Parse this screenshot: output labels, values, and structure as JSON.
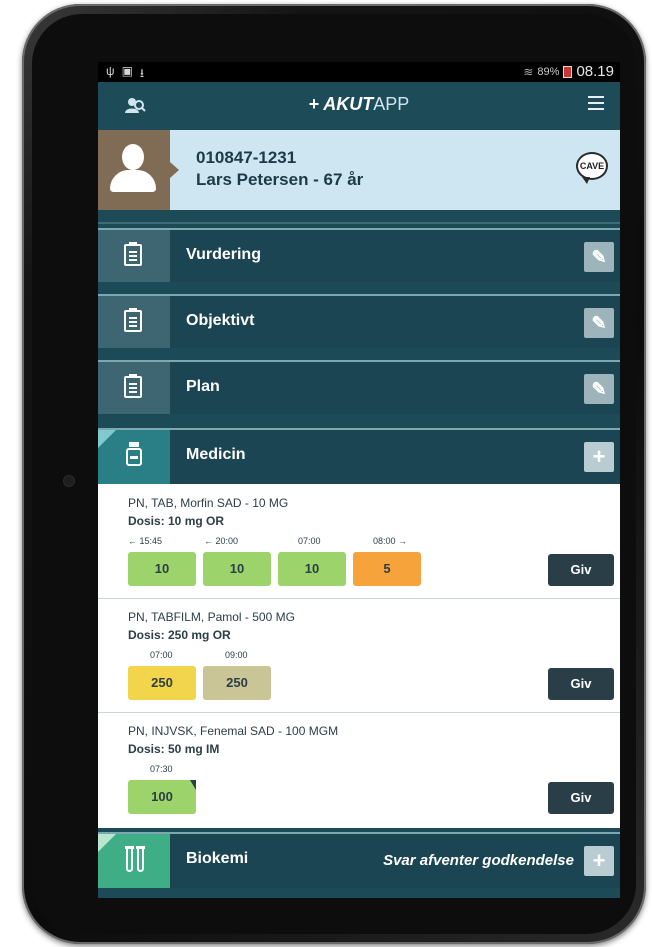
{
  "status_bar": {
    "left_icons": [
      "usb-icon",
      "screenshot-icon",
      "download-icon"
    ],
    "signal_icon": "wifi-icon",
    "battery": "89%",
    "time": "08.19"
  },
  "header": {
    "plus": "+",
    "brand_bold": "AKUT",
    "brand_light": "APP",
    "user_icon": "user-search-icon",
    "menu_icon": "hamburger-menu-icon"
  },
  "patient": {
    "cpr": "010847-1231",
    "name_age": "Lars Petersen - 67 år",
    "cave_label": "CAVE"
  },
  "sections": [
    {
      "label": "Vurdering",
      "icon": "clipboard-icon",
      "action_icon": "edit-icon"
    },
    {
      "label": "Objektivt",
      "icon": "clipboard-icon",
      "action_icon": "edit-icon"
    },
    {
      "label": "Plan",
      "icon": "clipboard-icon",
      "action_icon": "edit-icon"
    },
    {
      "label": "Medicin",
      "icon": "medicine-bottle-icon",
      "action": "+"
    }
  ],
  "medications": [
    {
      "title": "PN, TAB, Morfin SAD - 10 MG",
      "dose": "Dosis: 10 mg OR",
      "times": [
        "← 15:45",
        "← 20:00",
        "07:00",
        "08:00 →"
      ],
      "values": [
        "10",
        "10",
        "10",
        "5"
      ],
      "button": "Giv"
    },
    {
      "title": "PN, TABFILM, Pamol - 500 MG",
      "dose": "Dosis: 250 mg OR",
      "times": [
        "07:00",
        "09:00"
      ],
      "values": [
        "250",
        "250"
      ],
      "button": "Giv"
    },
    {
      "title": "PN, INJVSK, Fenemal SAD - 100 MGM",
      "dose": "Dosis: 50 mg IM",
      "times": [
        "07:30"
      ],
      "values": [
        "100"
      ],
      "button": "Giv"
    }
  ],
  "biokemi": {
    "label": "Biokemi",
    "icon": "test-tubes-icon",
    "status": "Svar afventer godkendelse",
    "action": "+"
  },
  "colors": {
    "header_bg": "#1e4b58",
    "patient_bg": "#cde6f1",
    "dose_green": "#9cd36a",
    "dose_orange": "#f7a33b",
    "dose_yellow": "#f2d54b",
    "dose_khaki": "#c9c596",
    "giv_button": "#2a3e48"
  }
}
